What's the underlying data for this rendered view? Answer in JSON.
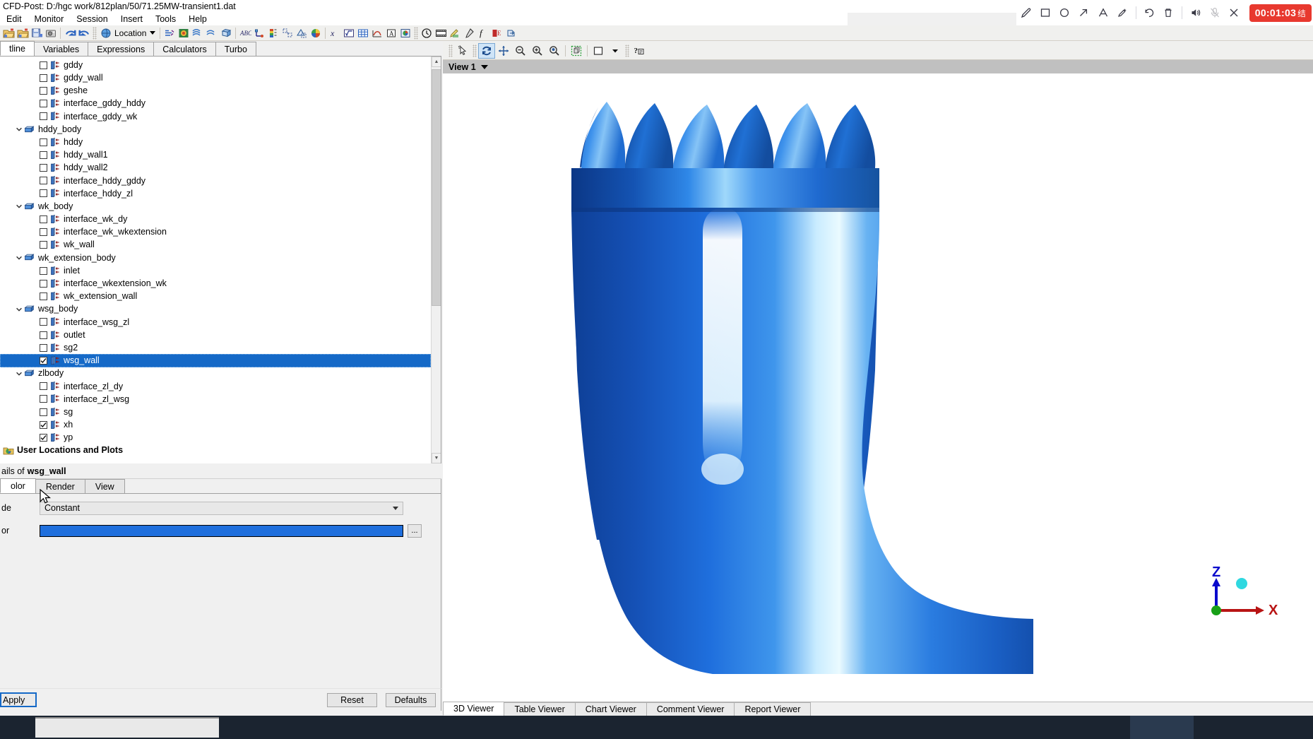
{
  "titlebar": {
    "title": "CFD-Post: D:/hgc work/812plan/50/71.25MW-transient1.dat"
  },
  "recorder": {
    "timer": "00:01:03",
    "stop_label": "结",
    "buttons": [
      {
        "name": "pen-icon",
        "label": "Pen"
      },
      {
        "name": "rectangle-icon",
        "label": "Rectangle"
      },
      {
        "name": "ellipse-icon",
        "label": "Ellipse"
      },
      {
        "name": "arrow-icon",
        "label": "Arrow"
      },
      {
        "name": "text-icon",
        "label": "Text"
      },
      {
        "name": "highlighter-icon",
        "label": "Highlighter"
      },
      {
        "name": "undo-icon",
        "label": "Undo"
      },
      {
        "name": "delete-icon",
        "label": "Delete"
      },
      {
        "name": "speaker-icon",
        "label": "Speaker"
      },
      {
        "name": "microphone-muted-icon",
        "label": "Microphone muted"
      },
      {
        "name": "close-icon",
        "label": "Close"
      }
    ]
  },
  "menubar": {
    "items": [
      {
        "label": "Edit"
      },
      {
        "label": "Monitor"
      },
      {
        "label": "Session"
      },
      {
        "label": "Insert"
      },
      {
        "label": "Tools"
      },
      {
        "label": "Help"
      }
    ]
  },
  "toolbar": {
    "location_label": "Location",
    "icons": [
      "open-file-icon",
      "open-state-icon",
      "save-state-icon",
      "screenshot-icon",
      "undo-icon",
      "redo-icon",
      "location-icon",
      "vector-icon",
      "contour-icon",
      "streamline-icon",
      "particle-track-icon",
      "volume-render-icon",
      "text-abc-icon",
      "coordinate-frame-icon",
      "legend-icon",
      "instancing-transform-icon",
      "clip-plane-icon",
      "color-map-icon",
      "expression-icon",
      "variable-icon",
      "table-icon",
      "chart-icon",
      "comment-icon",
      "report-icon",
      "timestep-icon",
      "animation-icon",
      "macro-icon",
      "probe-icon",
      "function-icon",
      "mesh-calculator-icon",
      "export-icon"
    ]
  },
  "left_panel": {
    "tabs": [
      {
        "label": "tline",
        "active": true
      },
      {
        "label": "Variables",
        "active": false
      },
      {
        "label": "Expressions",
        "active": false
      },
      {
        "label": "Calculators",
        "active": false
      },
      {
        "label": "Turbo",
        "active": false
      }
    ],
    "tree": [
      {
        "label": "gddy",
        "indent": 2,
        "type": "boundary",
        "checked": false,
        "selected": false
      },
      {
        "label": "gddy_wall",
        "indent": 2,
        "type": "boundary",
        "checked": false,
        "selected": false
      },
      {
        "label": "geshe",
        "indent": 2,
        "type": "boundary",
        "checked": false,
        "selected": false
      },
      {
        "label": "interface_gddy_hddy",
        "indent": 2,
        "type": "boundary",
        "checked": false,
        "selected": false
      },
      {
        "label": "interface_gddy_wk",
        "indent": 2,
        "type": "boundary",
        "checked": false,
        "selected": false
      },
      {
        "label": "hddy_body",
        "indent": 1,
        "type": "domain",
        "expanded": true
      },
      {
        "label": "hddy",
        "indent": 2,
        "type": "boundary",
        "checked": false,
        "selected": false
      },
      {
        "label": "hddy_wall1",
        "indent": 2,
        "type": "boundary",
        "checked": false,
        "selected": false
      },
      {
        "label": "hddy_wall2",
        "indent": 2,
        "type": "boundary",
        "checked": false,
        "selected": false
      },
      {
        "label": "interface_hddy_gddy",
        "indent": 2,
        "type": "boundary",
        "checked": false,
        "selected": false
      },
      {
        "label": "interface_hddy_zl",
        "indent": 2,
        "type": "boundary",
        "checked": false,
        "selected": false
      },
      {
        "label": "wk_body",
        "indent": 1,
        "type": "domain",
        "expanded": true
      },
      {
        "label": "interface_wk_dy",
        "indent": 2,
        "type": "boundary",
        "checked": false,
        "selected": false
      },
      {
        "label": "interface_wk_wkextension",
        "indent": 2,
        "type": "boundary",
        "checked": false,
        "selected": false
      },
      {
        "label": "wk_wall",
        "indent": 2,
        "type": "boundary",
        "checked": false,
        "selected": false
      },
      {
        "label": "wk_extension_body",
        "indent": 1,
        "type": "domain",
        "expanded": true
      },
      {
        "label": "inlet",
        "indent": 2,
        "type": "boundary",
        "checked": false,
        "selected": false
      },
      {
        "label": "interface_wkextension_wk",
        "indent": 2,
        "type": "boundary",
        "checked": false,
        "selected": false
      },
      {
        "label": "wk_extension_wall",
        "indent": 2,
        "type": "boundary",
        "checked": false,
        "selected": false
      },
      {
        "label": "wsg_body",
        "indent": 1,
        "type": "domain",
        "expanded": true
      },
      {
        "label": "interface_wsg_zl",
        "indent": 2,
        "type": "boundary",
        "checked": false,
        "selected": false
      },
      {
        "label": "outlet",
        "indent": 2,
        "type": "boundary",
        "checked": false,
        "selected": false
      },
      {
        "label": "sg2",
        "indent": 2,
        "type": "boundary",
        "checked": false,
        "selected": false
      },
      {
        "label": "wsg_wall",
        "indent": 2,
        "type": "boundary",
        "checked": true,
        "selected": true
      },
      {
        "label": "zlbody",
        "indent": 1,
        "type": "domain",
        "expanded": true
      },
      {
        "label": "interface_zl_dy",
        "indent": 2,
        "type": "boundary",
        "checked": false,
        "selected": false
      },
      {
        "label": "interface_zl_wsg",
        "indent": 2,
        "type": "boundary",
        "checked": false,
        "selected": false
      },
      {
        "label": "sg",
        "indent": 2,
        "type": "boundary",
        "checked": false,
        "selected": false
      },
      {
        "label": "xh",
        "indent": 2,
        "type": "boundary",
        "checked": true,
        "selected": false
      },
      {
        "label": "yp",
        "indent": 2,
        "type": "boundary",
        "checked": true,
        "selected": false
      },
      {
        "label": "User Locations and Plots",
        "indent": 0,
        "type": "folder",
        "bold": true
      }
    ]
  },
  "details": {
    "header_prefix": "ails of",
    "header_name": "wsg_wall",
    "tabs": [
      {
        "label": "olor",
        "active": true
      },
      {
        "label": "Render",
        "active": false
      },
      {
        "label": "View",
        "active": false
      }
    ],
    "mode_label": "de",
    "mode_value": "Constant",
    "color_label": "or",
    "color_value": "#1f6fdd",
    "ellipsis_label": "...",
    "buttons": {
      "apply": "Apply",
      "reset": "Reset",
      "defaults": "Defaults"
    }
  },
  "viewer": {
    "toolbar_icons": [
      "select-pointer-icon",
      "rotate-icon",
      "pan-icon",
      "zoom-out-icon",
      "zoom-in-icon",
      "zoom-box-icon",
      "fit-view-icon",
      "background-color-icon",
      "chevron-down-icon",
      "whats-this-icon"
    ],
    "view_label": "View 1",
    "axis": {
      "z_label": "Z",
      "x_label": "X"
    },
    "tabs": [
      {
        "label": "3D Viewer",
        "active": true
      },
      {
        "label": "Table Viewer",
        "active": false
      },
      {
        "label": "Chart Viewer",
        "active": false
      },
      {
        "label": "Comment Viewer",
        "active": false
      },
      {
        "label": "Report Viewer",
        "active": false
      }
    ]
  },
  "colors": {
    "selection_blue": "#1569c7",
    "surface_blue": "#1f6fdd",
    "record_red": "#e8392f",
    "viewbar_gray": "#c0c0c0"
  }
}
